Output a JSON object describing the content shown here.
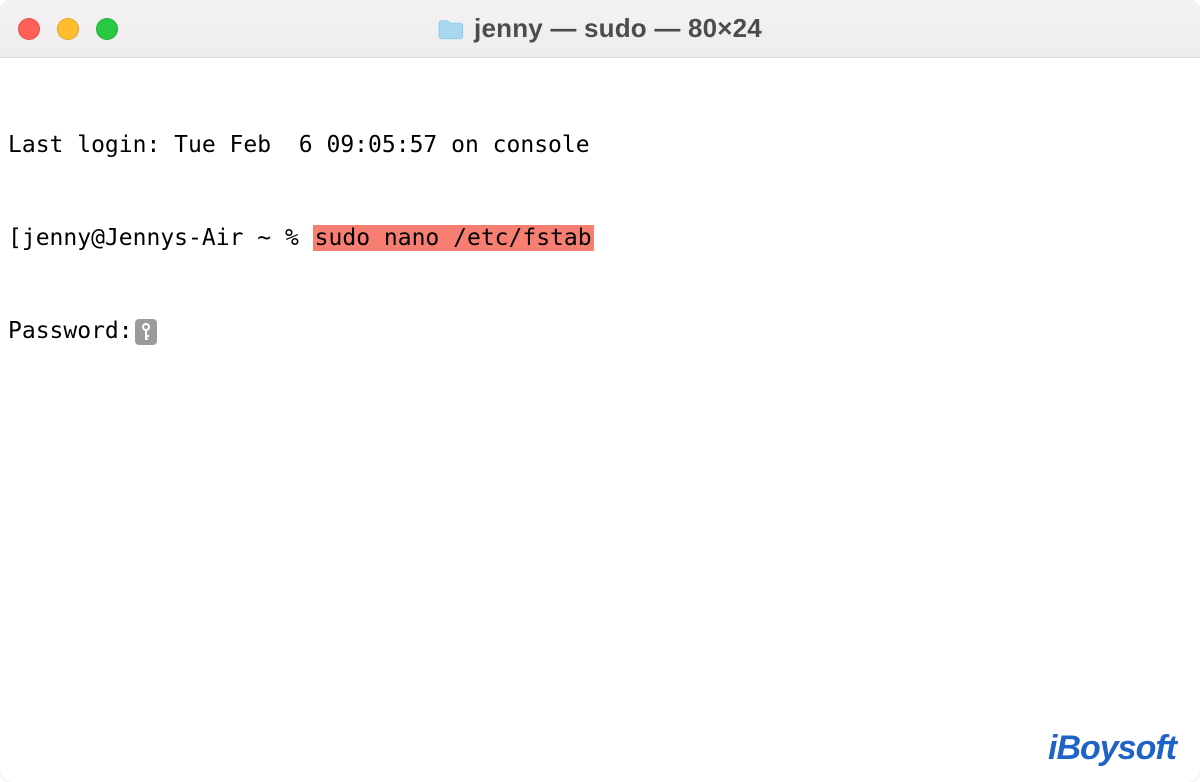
{
  "window": {
    "title": "jenny — sudo — 80×24",
    "traffic_lights": {
      "close_color": "#ff5f57",
      "minimize_color": "#febc2e",
      "maximize_color": "#28c840"
    }
  },
  "terminal": {
    "last_login_line": "Last login: Tue Feb  6 09:05:57 on console",
    "prompt_bracket": "[",
    "prompt": "jenny@Jennys-Air ~ % ",
    "command_highlighted": "sudo nano /etc/fstab",
    "password_label": "Password:",
    "highlight_color": "#f87e72"
  },
  "watermark": {
    "text": "iBoysoft"
  }
}
